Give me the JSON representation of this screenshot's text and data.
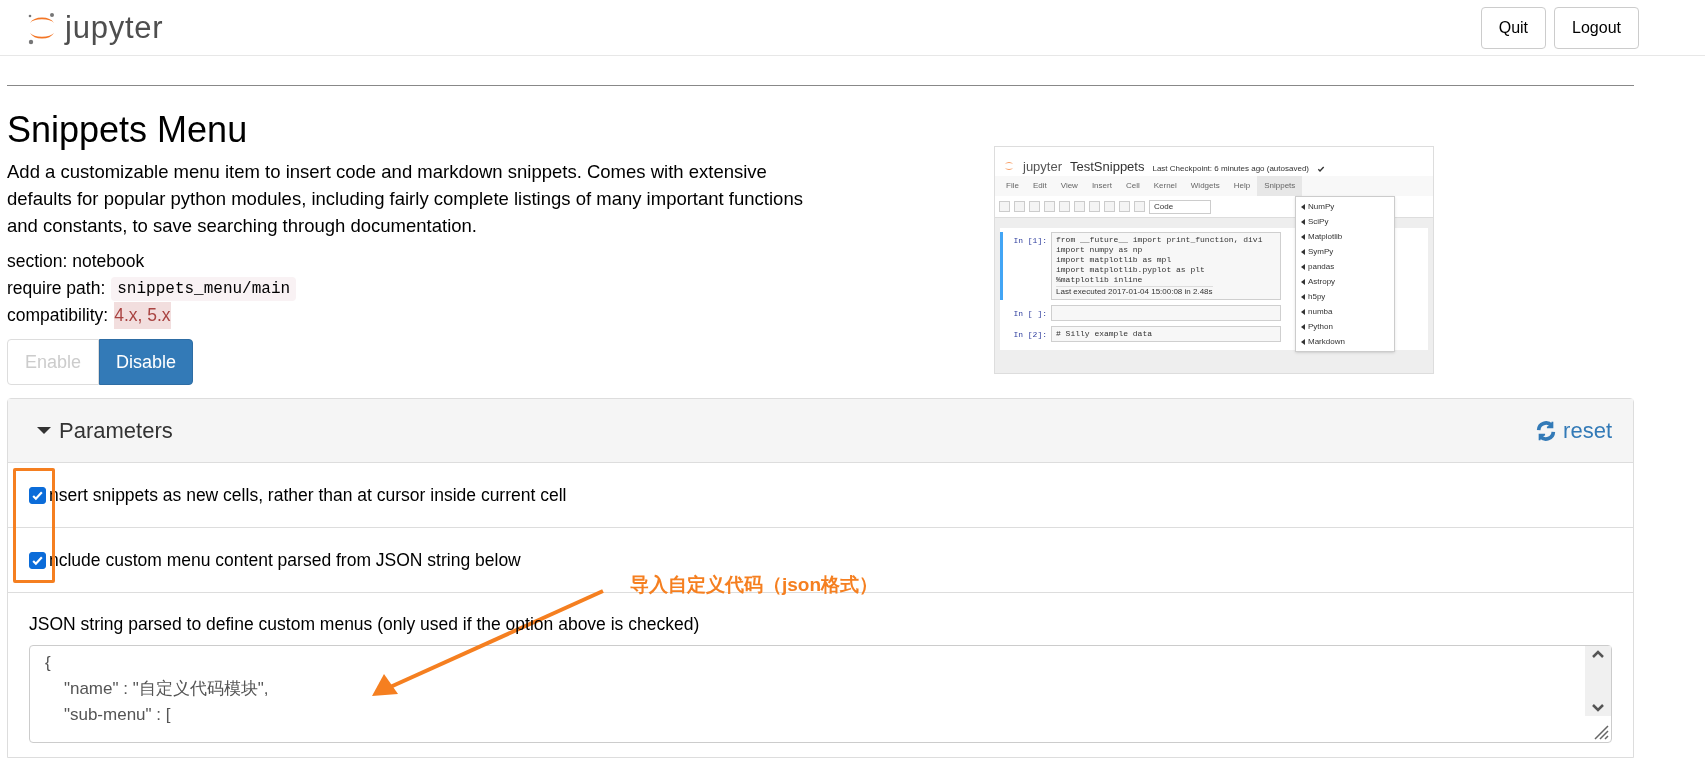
{
  "header": {
    "logo_text": "jupyter",
    "buttons": [
      "Quit",
      "Logout"
    ]
  },
  "extension": {
    "title": "Snippets Menu",
    "description": "Add a customizable menu item to insert code and markdown snippets. Comes with extensive defaults for popular python modules, including fairly complete listings of many important functions and constants, to save searching through documentation.",
    "section_label": "section: notebook",
    "require_label": "require path:",
    "require_path": "snippets_menu/main",
    "compat_label": "compatibility:",
    "compat_value": "4.x, 5.x",
    "toggle": [
      {
        "label": "Enable",
        "selected": false
      },
      {
        "label": "Disable",
        "selected": true
      }
    ]
  },
  "preview": {
    "logo_text": "jupyter",
    "notebook_title": "TestSnippets",
    "checkpoint": "Last Checkpoint: 6 minutes ago (autosaved)",
    "menu": [
      {
        "label": "File",
        "selected": false
      },
      {
        "label": "Edit",
        "selected": false
      },
      {
        "label": "View",
        "selected": false
      },
      {
        "label": "Insert",
        "selected": false
      },
      {
        "label": "Cell",
        "selected": false
      },
      {
        "label": "Kernel",
        "selected": false
      },
      {
        "label": "Widgets",
        "selected": false
      },
      {
        "label": "Help",
        "selected": false
      },
      {
        "label": "Snippets",
        "selected": true
      }
    ],
    "cell_type": "Code",
    "cells": [
      {
        "prompt": "In [1]:",
        "selected": true,
        "lines": [
          "from __future__ import print_function, divi",
          "import numpy as np",
          "import matplotlib as mpl",
          "import matplotlib.pyplot as plt",
          "%matplotlib inline"
        ],
        "footer": "Last executed 2017-01-04 15:00:08 in 2.48s"
      },
      {
        "prompt": "In [ ]:",
        "selected": false
      },
      {
        "prompt": "In [2]:",
        "selected": false,
        "lines": [
          "# Silly example data"
        ]
      }
    ],
    "snippets_menu": [
      "NumPy",
      "SciPy",
      "Matplotlib",
      "SymPy",
      "pandas",
      "Astropy",
      "h5py",
      "numba",
      "Python",
      "Markdown"
    ]
  },
  "parameters": {
    "title": "Parameters",
    "expanded": true,
    "reset": "reset",
    "options": [
      {
        "label": "nsert snippets as new cells, rather than at cursor inside current cell",
        "checked": true
      },
      {
        "label": "nclude custom menu content parsed from JSON string below",
        "checked": true
      }
    ],
    "json_label": "JSON string parsed to define custom menus (only used if the option above is checked)",
    "json_lines": [
      "{",
      "    \"name\" : \"自定义代码模块\",",
      "    \"sub-menu\" : ["
    ]
  },
  "annotation": {
    "text": "导入自定义代码（json格式）"
  }
}
